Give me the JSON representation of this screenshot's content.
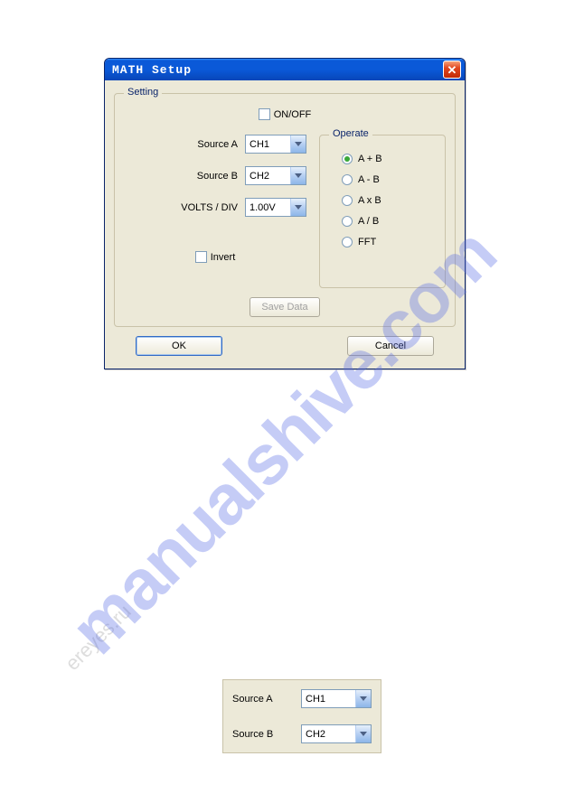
{
  "window": {
    "title": "MATH Setup"
  },
  "setting": {
    "legend": "Setting",
    "onoff_label": "ON/OFF",
    "sourceA_label": "Source A",
    "sourceA_value": "CH1",
    "sourceB_label": "Source B",
    "sourceB_value": "CH2",
    "voltsdiv_label": "VOLTS / DIV",
    "voltsdiv_value": "1.00V",
    "invert_label": "Invert",
    "save_label": "Save Data"
  },
  "operate": {
    "legend": "Operate",
    "options": [
      "A + B",
      "A -  B",
      "A x B",
      "A / B",
      "FFT"
    ],
    "selected_index": 0
  },
  "buttons": {
    "ok": "OK",
    "cancel": "Cancel"
  },
  "mini": {
    "sourceA_label": "Source A",
    "sourceA_value": "CH1",
    "sourceB_label": "Source B",
    "sourceB_value": "CH2"
  },
  "watermark": {
    "main": "manualshive.com",
    "small": "ereyes.ru"
  }
}
